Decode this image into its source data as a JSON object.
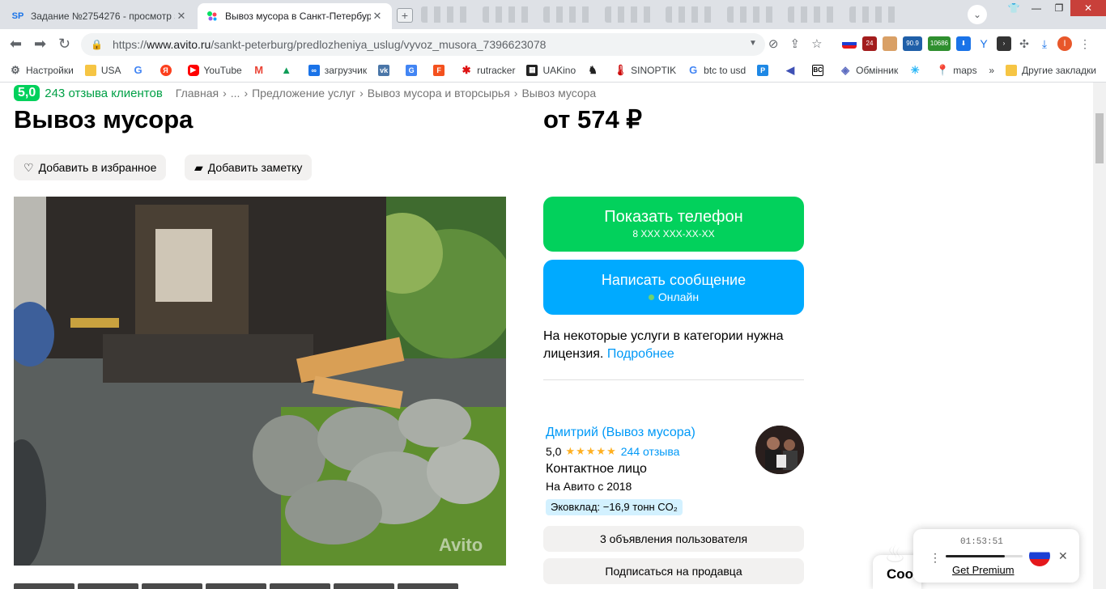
{
  "browser": {
    "tabs": [
      {
        "favicon": "SP",
        "title": "Задание №2754276 - просмотр з"
      },
      {
        "favicon": "avito-dots-icon",
        "title": "Вывоз мусора в Санкт-Петербург"
      }
    ],
    "url_prefix": "https://",
    "url_domain": "www.avito.ru",
    "url_path": "/sankt-peterburg/predlozheniya_uslug/vyvoz_musora_7396623078",
    "extension_badges": {
      "b1": "24",
      "b2": "90.9",
      "b3": "10686"
    },
    "profile_initial": "I"
  },
  "bookmarks": {
    "items": [
      "Настройки",
      "USA",
      "",
      "",
      "YouTube",
      "",
      "",
      "загрузчик",
      "",
      "",
      "",
      "rutracker",
      "UAKino",
      "",
      "SINOPTIK",
      "btc to usd",
      "",
      "",
      "",
      "Обмінник",
      "",
      "maps"
    ],
    "more": "»",
    "other": "Другие закладки"
  },
  "listing": {
    "rating_badge": "5,0",
    "reviews_link": "243 отзыва клиентов",
    "breadcrumbs": [
      "Главная",
      "›",
      "...",
      "›",
      "Предложение услуг",
      "›",
      "Вывоз мусора и вторсырья",
      "›",
      "Вывоз мусора"
    ],
    "title": "Вывоз мусора",
    "price": "от 574 ₽",
    "favorite_label": "Добавить в избранное",
    "note_label": "Добавить заметку",
    "show_phone_label": "Показать телефон",
    "phone_mask": "8 XXX XXX-XX-XX",
    "message_label": "Написать сообщение",
    "online_label": "Онлайн",
    "license_text": "На некоторые услуги в категории нужна лицензия.",
    "license_link": "Подробнее",
    "watermark": "Avito"
  },
  "seller": {
    "name": "Дмитрий (Вывоз мусора)",
    "rating": "5,0",
    "stars": "★★★★★",
    "reviews_count": "244 отзыва",
    "role": "Контактное лицо",
    "since": "На Авито с 2018",
    "eco": "Эковклад: −16,9 тонн CO₂",
    "ads_button": "3 объявления пользователя",
    "subscribe_button": "Подписаться на продавца"
  },
  "overlays": {
    "chat_label": "Соо",
    "player_time": "01:53:51",
    "player_progress": 0.77,
    "premium_link": "Get Premium"
  }
}
